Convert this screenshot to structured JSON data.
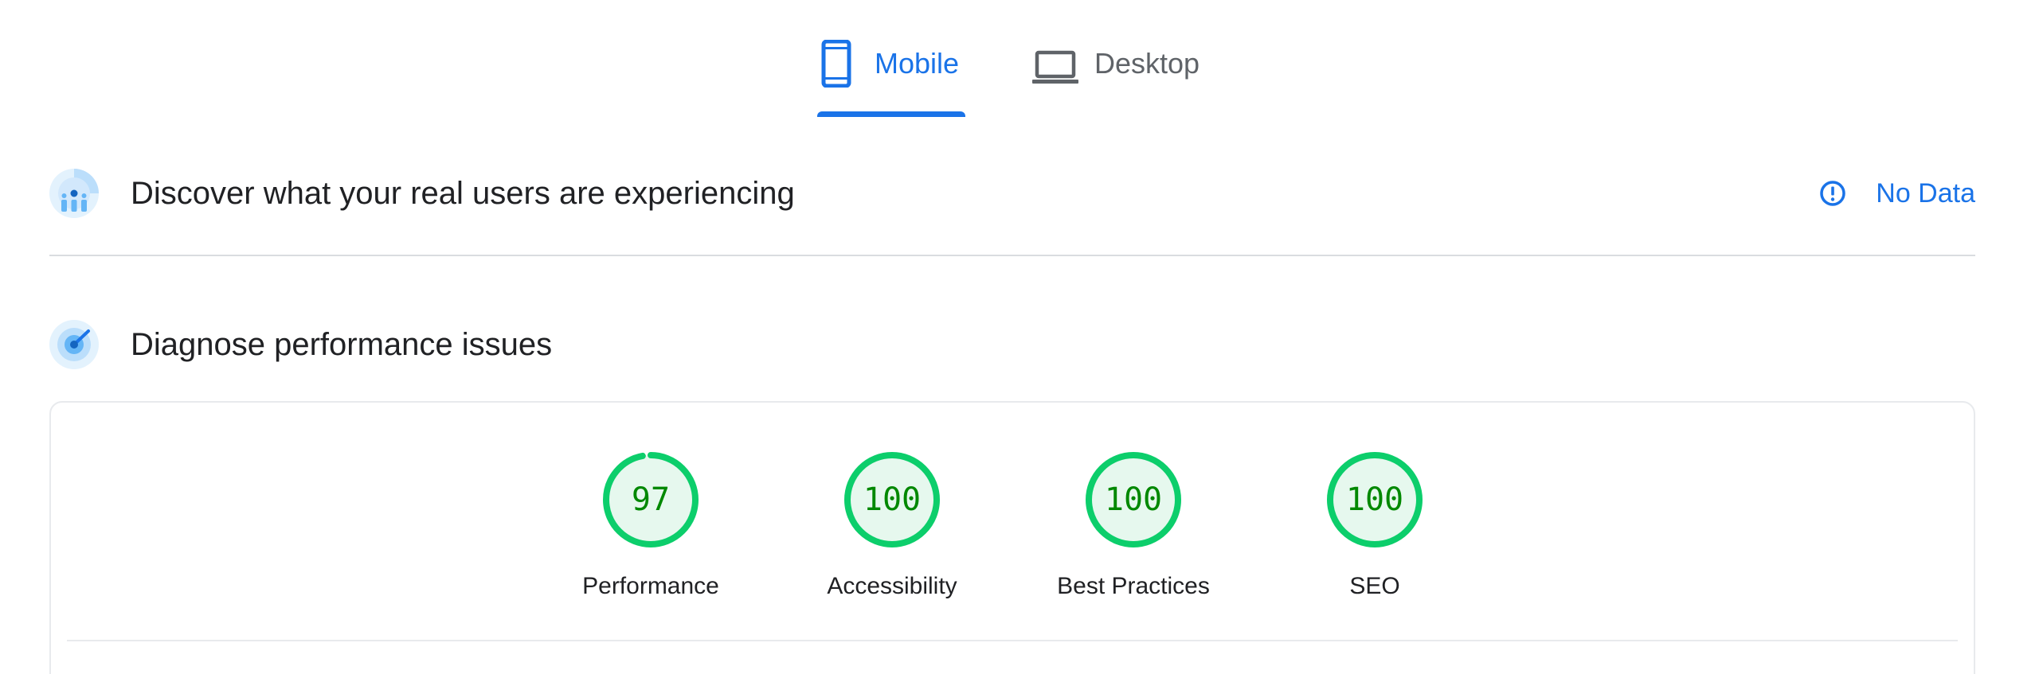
{
  "tabs": [
    {
      "label": "Mobile",
      "icon": "smartphone-icon",
      "active": true
    },
    {
      "label": "Desktop",
      "icon": "laptop-icon",
      "active": false
    }
  ],
  "field_section": {
    "title": "Discover what your real users are experiencing",
    "icon": "users-experience-icon",
    "status": {
      "icon": "info-icon",
      "label": "No Data"
    }
  },
  "diagnose_section": {
    "title": "Diagnose performance issues",
    "icon": "lighthouse-icon"
  },
  "scores": [
    {
      "label": "Performance",
      "score": "97",
      "value": 0.97
    },
    {
      "label": "Accessibility",
      "score": "100",
      "value": 1.0
    },
    {
      "label": "Best Practices",
      "score": "100",
      "value": 1.0
    },
    {
      "label": "SEO",
      "score": "100",
      "value": 1.0
    }
  ],
  "colors": {
    "accent": "#1a73e8",
    "pass": "#0cce6b",
    "pass_text": "#008800",
    "pass_fill": "#e6f8ee"
  }
}
